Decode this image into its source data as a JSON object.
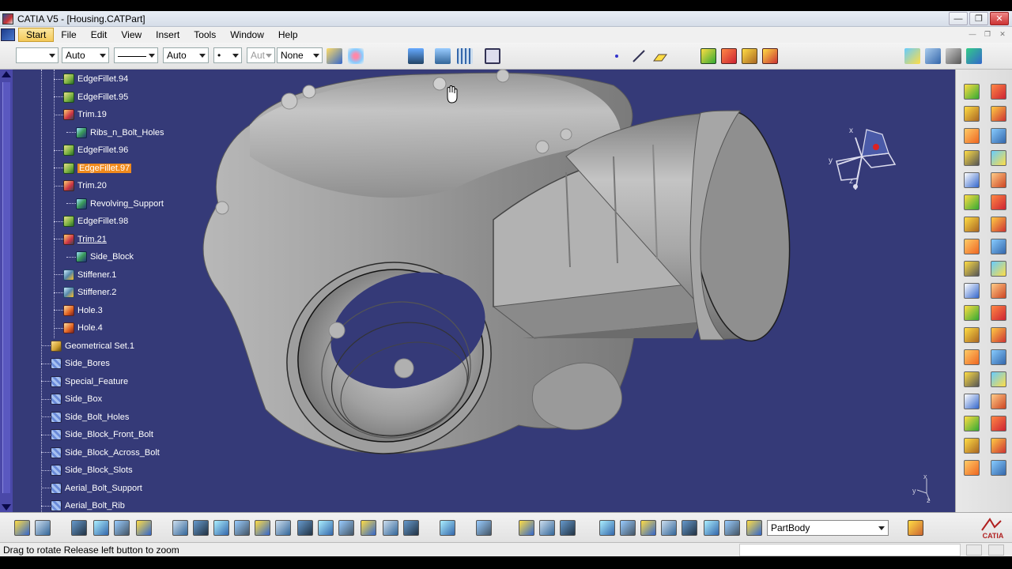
{
  "window": {
    "title": "CATIA V5 - [Housing.CATPart]",
    "minimize_glyph": "—",
    "maximize_glyph": "❐",
    "close_glyph": "✕"
  },
  "menu": {
    "items": [
      {
        "label": "Start",
        "active": true
      },
      {
        "label": "File"
      },
      {
        "label": "Edit"
      },
      {
        "label": "View"
      },
      {
        "label": "Insert"
      },
      {
        "label": "Tools"
      },
      {
        "label": "Window"
      },
      {
        "label": "Help"
      }
    ],
    "mdi": [
      "—",
      "❐",
      "✕"
    ]
  },
  "toolbar": {
    "color_select": "",
    "linetype_select": "Auto",
    "lineweight_select": "",
    "layer_select": "Auto",
    "point_select": "•",
    "aut_select": "Aut",
    "none_select": "None"
  },
  "tree": {
    "nodes": [
      {
        "label": "EdgeFillet.94",
        "icon": "fillet",
        "level": 1
      },
      {
        "label": "EdgeFillet.95",
        "icon": "fillet",
        "level": 1
      },
      {
        "label": "Trim.19",
        "icon": "trim",
        "level": 1
      },
      {
        "label": "Ribs_n_Bolt_Holes",
        "icon": "body",
        "level": 2
      },
      {
        "label": "EdgeFillet.96",
        "icon": "fillet",
        "level": 1
      },
      {
        "label": "EdgeFillet.97",
        "icon": "fillet",
        "level": 1,
        "highlight": true
      },
      {
        "label": "Trim.20",
        "icon": "trim",
        "level": 1
      },
      {
        "label": "Revolving_Support",
        "icon": "body",
        "level": 2
      },
      {
        "label": "EdgeFillet.98",
        "icon": "fillet",
        "level": 1
      },
      {
        "label": "Trim.21",
        "icon": "trim",
        "level": 1,
        "underline": true
      },
      {
        "label": "Side_Block",
        "icon": "body",
        "level": 2
      },
      {
        "label": "Stiffener.1",
        "icon": "stiff",
        "level": 1
      },
      {
        "label": "Stiffener.2",
        "icon": "stiff",
        "level": 1
      },
      {
        "label": "Hole.3",
        "icon": "hole",
        "level": 1
      },
      {
        "label": "Hole.4",
        "icon": "hole",
        "level": 1
      },
      {
        "label": "Geometrical Set.1",
        "icon": "geo",
        "level": 0
      },
      {
        "label": "Side_Bores",
        "icon": "sketch",
        "level": 0
      },
      {
        "label": "Special_Feature",
        "icon": "sketch",
        "level": 0
      },
      {
        "label": "Side_Box",
        "icon": "sketch",
        "level": 0
      },
      {
        "label": "Side_Bolt_Holes",
        "icon": "sketch",
        "level": 0
      },
      {
        "label": "Side_Block_Front_Bolt",
        "icon": "sketch",
        "level": 0
      },
      {
        "label": "Side_Block_Across_Bolt",
        "icon": "sketch",
        "level": 0
      },
      {
        "label": "Side_Block_Slots",
        "icon": "sketch",
        "level": 0
      },
      {
        "label": "Aerial_Bolt_Support",
        "icon": "sketch",
        "level": 0
      },
      {
        "label": "Aerial_Bolt_Rib",
        "icon": "sketch",
        "level": 0
      }
    ]
  },
  "compass": {
    "x_label": "x",
    "y_label": "y",
    "z_label": "z"
  },
  "axis_mini": {
    "x_label": "x",
    "y_label": "y",
    "z_label": "z"
  },
  "bottom": {
    "body_select": "PartBody",
    "logo_text": "CATIA"
  },
  "status": {
    "message": "Drag to rotate  Release left button to zoom"
  },
  "colors": {
    "viewport_bg": "#353a78",
    "highlight": "#f08a1c",
    "part_gray": "#9c9c9c"
  }
}
